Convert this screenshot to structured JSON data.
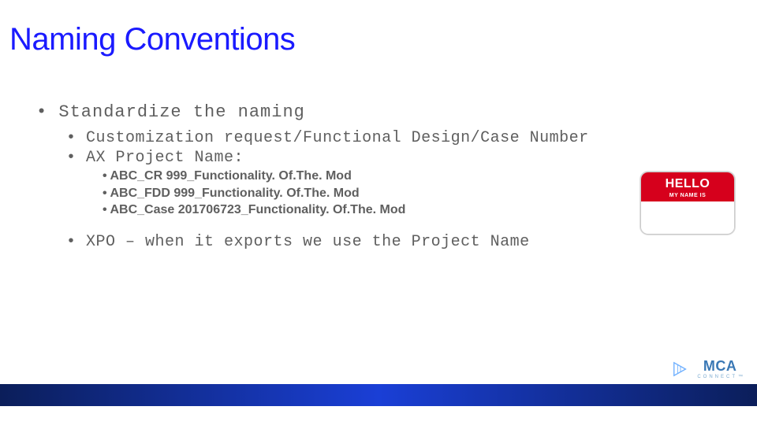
{
  "title": "Naming Conventions",
  "content": {
    "line1": "Standardize the naming",
    "line2a": "Customization request/Functional Design/Case Number",
    "line2b": "AX Project Name:",
    "examples": [
      "ABC_CR 999_Functionality. Of.The. Mod",
      "ABC_FDD 999_Functionality. Of.The. Mod",
      "ABC_Case 201706723_Functionality. Of.The. Mod"
    ],
    "line_xpo": "XPO – when it exports we use the Project Name"
  },
  "nametag": {
    "hello": "HELLO",
    "sub": "MY NAME IS"
  },
  "footer": {
    "mca": "MCA",
    "connect": "CONNECT"
  }
}
